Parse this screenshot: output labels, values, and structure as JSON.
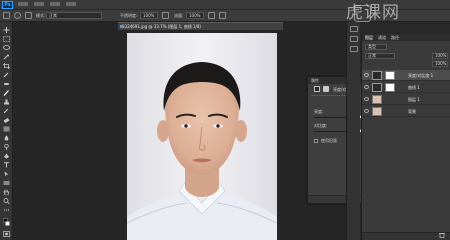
{
  "app": {
    "logo_text": "Ps"
  },
  "watermark": {
    "text": "虎课网"
  },
  "options_bar": {
    "mode_value": "正常",
    "opacity_label": "不透明度:",
    "opacity_value": "100%",
    "flow_label": "流量:",
    "flow_value": "100%"
  },
  "document": {
    "tab_title": "8324691.jpg @ 33.7% (图层 1, 曲线 1/8)",
    "canvas_description": "portrait"
  },
  "properties_panel": {
    "title": "属性",
    "adjustment_type": "亮度/对比度",
    "auto_button": "自动",
    "brightness": {
      "label": "亮度:",
      "value": "11",
      "fraction": 0.55
    },
    "contrast": {
      "label": "对比度:",
      "value": "11",
      "fraction": 0.55
    },
    "legacy_label": "使用旧版"
  },
  "layers_panel": {
    "tabs": [
      "图层",
      "通道",
      "路径"
    ],
    "kind_value": "类型",
    "blend_value": "正常",
    "opacity_value": "100%",
    "fill_value": "100%",
    "layers": [
      {
        "name": "亮度/对比度 1",
        "selected": true
      },
      {
        "name": "曲线 1",
        "selected": false
      },
      {
        "name": "图层 1",
        "selected": false
      },
      {
        "name": "背景",
        "selected": false
      }
    ]
  },
  "colors": {
    "accent": "#31a8ff",
    "panel": "#3e3e3e",
    "background": "#282828"
  }
}
